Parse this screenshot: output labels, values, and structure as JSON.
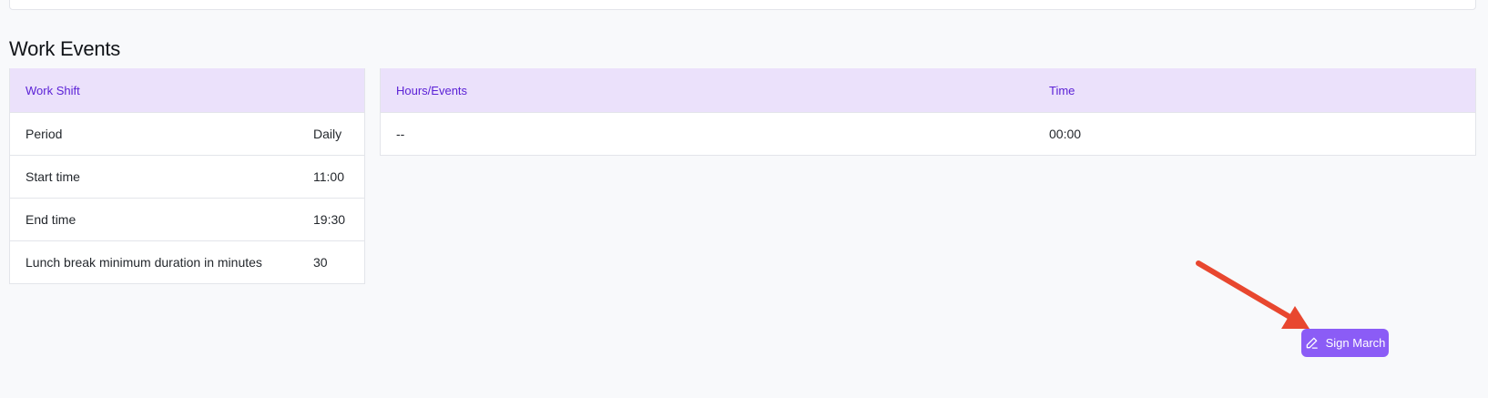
{
  "section": {
    "title": "Work Events"
  },
  "work_shift": {
    "header": "Work Shift",
    "rows": [
      {
        "label": "Period",
        "value": "Daily"
      },
      {
        "label": "Start time",
        "value": "11:00"
      },
      {
        "label": "End time",
        "value": "19:30"
      },
      {
        "label": "Lunch break minimum duration in minutes",
        "value": "30"
      }
    ]
  },
  "events": {
    "headers": {
      "hours_events": "Hours/Events",
      "time": "Time"
    },
    "rows": [
      {
        "hours_events": "--",
        "time": "00:00"
      }
    ]
  },
  "sign_button": {
    "label": "Sign March",
    "icon": "pencil-icon"
  },
  "colors": {
    "accent": "#8b5cf6",
    "header_bg": "#ebe1fb",
    "header_text": "#5b21d6",
    "annotation_arrow": "#e8472f"
  }
}
